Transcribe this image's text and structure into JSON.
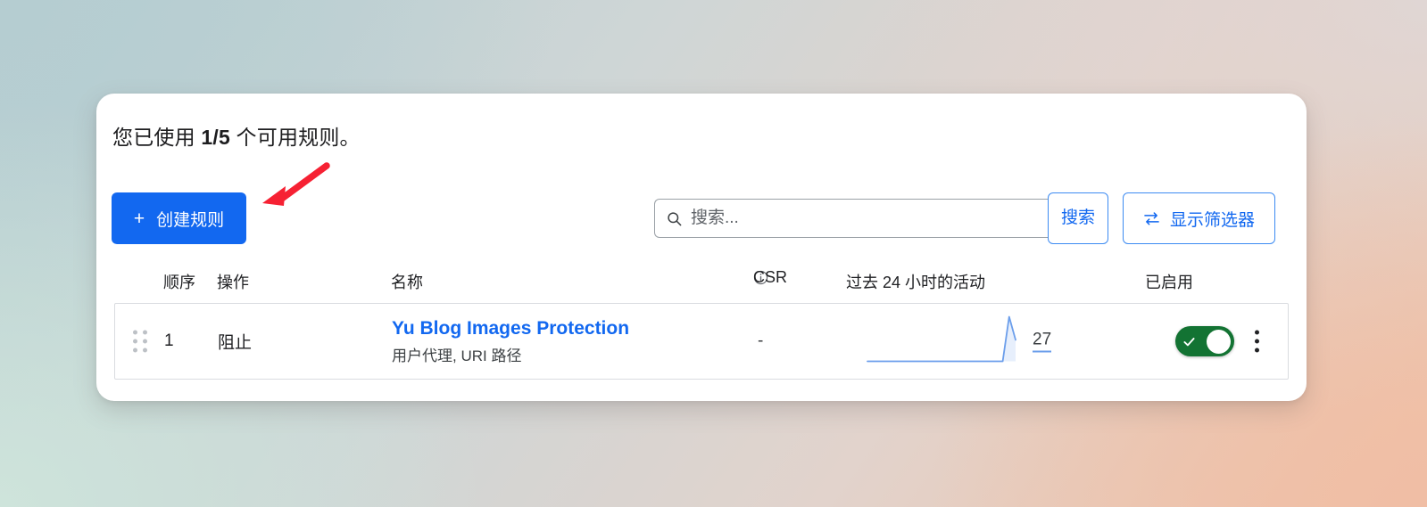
{
  "card": {
    "usage_prefix": "您已使用 ",
    "usage_count": "1/5",
    "usage_suffix": " 个可用规则。"
  },
  "toolbar": {
    "create_label": "创建规则",
    "create_plus": "+",
    "create_color": "#1268f0",
    "search_placeholder": "搜索...",
    "search_value": "",
    "search_button_label": "搜索",
    "filters_label": "显示筛选器",
    "filters_icon": "⇆",
    "link_color": "#1268f0"
  },
  "table": {
    "headers": {
      "order": "顺序",
      "action": "操作",
      "name": "名称",
      "csr": "CSR",
      "csr_info_icon": "info-icon",
      "activity": "过去 24 小时的活动",
      "enabled": "已启用"
    },
    "rows": [
      {
        "order": "1",
        "action": "阻止",
        "name": "Yu Blog Images Protection",
        "name_sub": "用户代理, URI 路径",
        "csr": "-",
        "activity_count": "27",
        "enabled": true
      }
    ]
  },
  "chart_data": {
    "type": "line",
    "title": "过去 24 小时的活动",
    "xlabel": "",
    "ylabel": "",
    "x": [
      0,
      1,
      2,
      3,
      4,
      5,
      6,
      7,
      8,
      9,
      10,
      11,
      12,
      13,
      14,
      15,
      16,
      17,
      18,
      19,
      20,
      21,
      22,
      23
    ],
    "values": [
      0,
      0,
      0,
      0,
      0,
      0,
      0,
      0,
      0,
      0,
      0,
      0,
      0,
      0,
      0,
      0,
      0,
      0,
      0,
      0,
      0,
      0,
      27,
      13
    ],
    "ylim": [
      0,
      27
    ],
    "grid": false,
    "legend": "none",
    "series_color": "#6b9eeb",
    "total_label": "27"
  },
  "annotation": {
    "arrow_color": "#f62133",
    "arrow_target": "创建规则"
  }
}
